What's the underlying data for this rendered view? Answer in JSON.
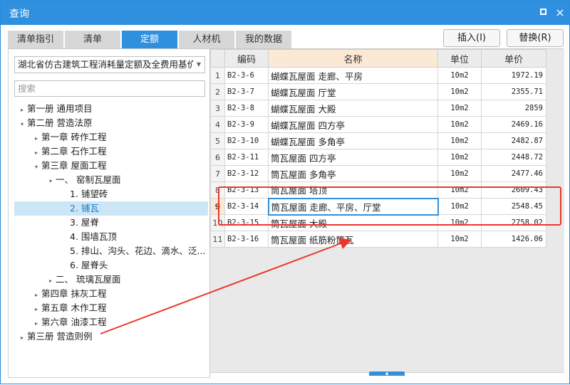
{
  "window": {
    "title": "查询",
    "maximize_icon": "maximize-icon",
    "close_icon": "close-icon",
    "close_glyph": "×"
  },
  "tabs": [
    {
      "label": "清单指引",
      "active": false
    },
    {
      "label": "清单",
      "active": false
    },
    {
      "label": "定额",
      "active": true
    },
    {
      "label": "人材机",
      "active": false
    },
    {
      "label": "我的数据",
      "active": false
    }
  ],
  "actions": {
    "insert_label": "插入(I)",
    "replace_label": "替换(R)"
  },
  "library_select": {
    "value": "湖北省仿古建筑工程消耗量定额及全费用基价表"
  },
  "search": {
    "placeholder": "搜索",
    "value": ""
  },
  "tree": [
    {
      "label": "第一册 通用项目",
      "level": 0,
      "caret": "▸",
      "selected": false
    },
    {
      "label": "第二册 营造法原",
      "level": 0,
      "caret": "▾",
      "selected": false
    },
    {
      "label": "第一章 砖作工程",
      "level": 1,
      "caret": "▸",
      "selected": false
    },
    {
      "label": "第二章 石作工程",
      "level": 1,
      "caret": "▸",
      "selected": false
    },
    {
      "label": "第三章 屋面工程",
      "level": 1,
      "caret": "▾",
      "selected": false
    },
    {
      "label": "一、 窑制瓦屋面",
      "level": 2,
      "caret": "▾",
      "selected": false
    },
    {
      "label": "1. 铺望砖",
      "level": 3,
      "caret": "",
      "selected": false
    },
    {
      "label": "2. 铺瓦",
      "level": 3,
      "caret": "",
      "selected": true
    },
    {
      "label": "3. 屋脊",
      "level": 3,
      "caret": "",
      "selected": false
    },
    {
      "label": "4. 围墙瓦顶",
      "level": 3,
      "caret": "",
      "selected": false
    },
    {
      "label": "5. 排山、沟头、花边、滴水、泛...",
      "level": 3,
      "caret": "",
      "selected": false
    },
    {
      "label": "6. 屋脊头",
      "level": 3,
      "caret": "",
      "selected": false
    },
    {
      "label": "二、 琉璃瓦屋面",
      "level": 2,
      "caret": "▸",
      "selected": false
    },
    {
      "label": "第四章 抹灰工程",
      "level": 1,
      "caret": "▸",
      "selected": false
    },
    {
      "label": "第五章 木作工程",
      "level": 1,
      "caret": "▸",
      "selected": false
    },
    {
      "label": "第六章 油漆工程",
      "level": 1,
      "caret": "▸",
      "selected": false
    },
    {
      "label": "第三册 营造则例",
      "level": 0,
      "caret": "▸",
      "selected": false
    }
  ],
  "grid": {
    "headers": {
      "code": "编码",
      "name": "名称",
      "unit": "单位",
      "price": "单价"
    },
    "current_row": 8,
    "rows": [
      {
        "num": "1",
        "code": "B2-3-6",
        "name": "蝴蝶瓦屋面 走廊、平房",
        "unit": "10m2",
        "price": "1972.19"
      },
      {
        "num": "2",
        "code": "B2-3-7",
        "name": "蝴蝶瓦屋面 厅堂",
        "unit": "10m2",
        "price": "2355.71"
      },
      {
        "num": "3",
        "code": "B2-3-8",
        "name": "蝴蝶瓦屋面 大殿",
        "unit": "10m2",
        "price": "2859"
      },
      {
        "num": "4",
        "code": "B2-3-9",
        "name": "蝴蝶瓦屋面 四方亭",
        "unit": "10m2",
        "price": "2469.16"
      },
      {
        "num": "5",
        "code": "B2-3-10",
        "name": "蝴蝶瓦屋面 多角亭",
        "unit": "10m2",
        "price": "2482.87"
      },
      {
        "num": "6",
        "code": "B2-3-11",
        "name": "筒瓦屋面 四方亭",
        "unit": "10m2",
        "price": "2448.72"
      },
      {
        "num": "7",
        "code": "B2-3-12",
        "name": "筒瓦屋面 多角亭",
        "unit": "10m2",
        "price": "2477.46"
      },
      {
        "num": "8",
        "code": "B2-3-13",
        "name": "筒瓦屋面 塔顶",
        "unit": "10m2",
        "price": "2609.43"
      },
      {
        "num": "9",
        "code": "B2-3-14",
        "name": "筒瓦屋面 走廊、平房、厅堂",
        "unit": "10m2",
        "price": "2548.45"
      },
      {
        "num": "10",
        "code": "B2-3-15",
        "name": "筒瓦屋面 大殿",
        "unit": "10m2",
        "price": "2758.02"
      },
      {
        "num": "11",
        "code": "B2-3-16",
        "name": "筒瓦屋面 纸筋粉筒瓦",
        "unit": "10m2",
        "price": "1426.06"
      }
    ]
  },
  "annotation": {
    "box_color": "#e8372b",
    "arrow_color": "#e8372b"
  },
  "colors": {
    "accent": "#2f90df",
    "selection": "#cde6f7",
    "current_row": "#fbe9d6"
  }
}
